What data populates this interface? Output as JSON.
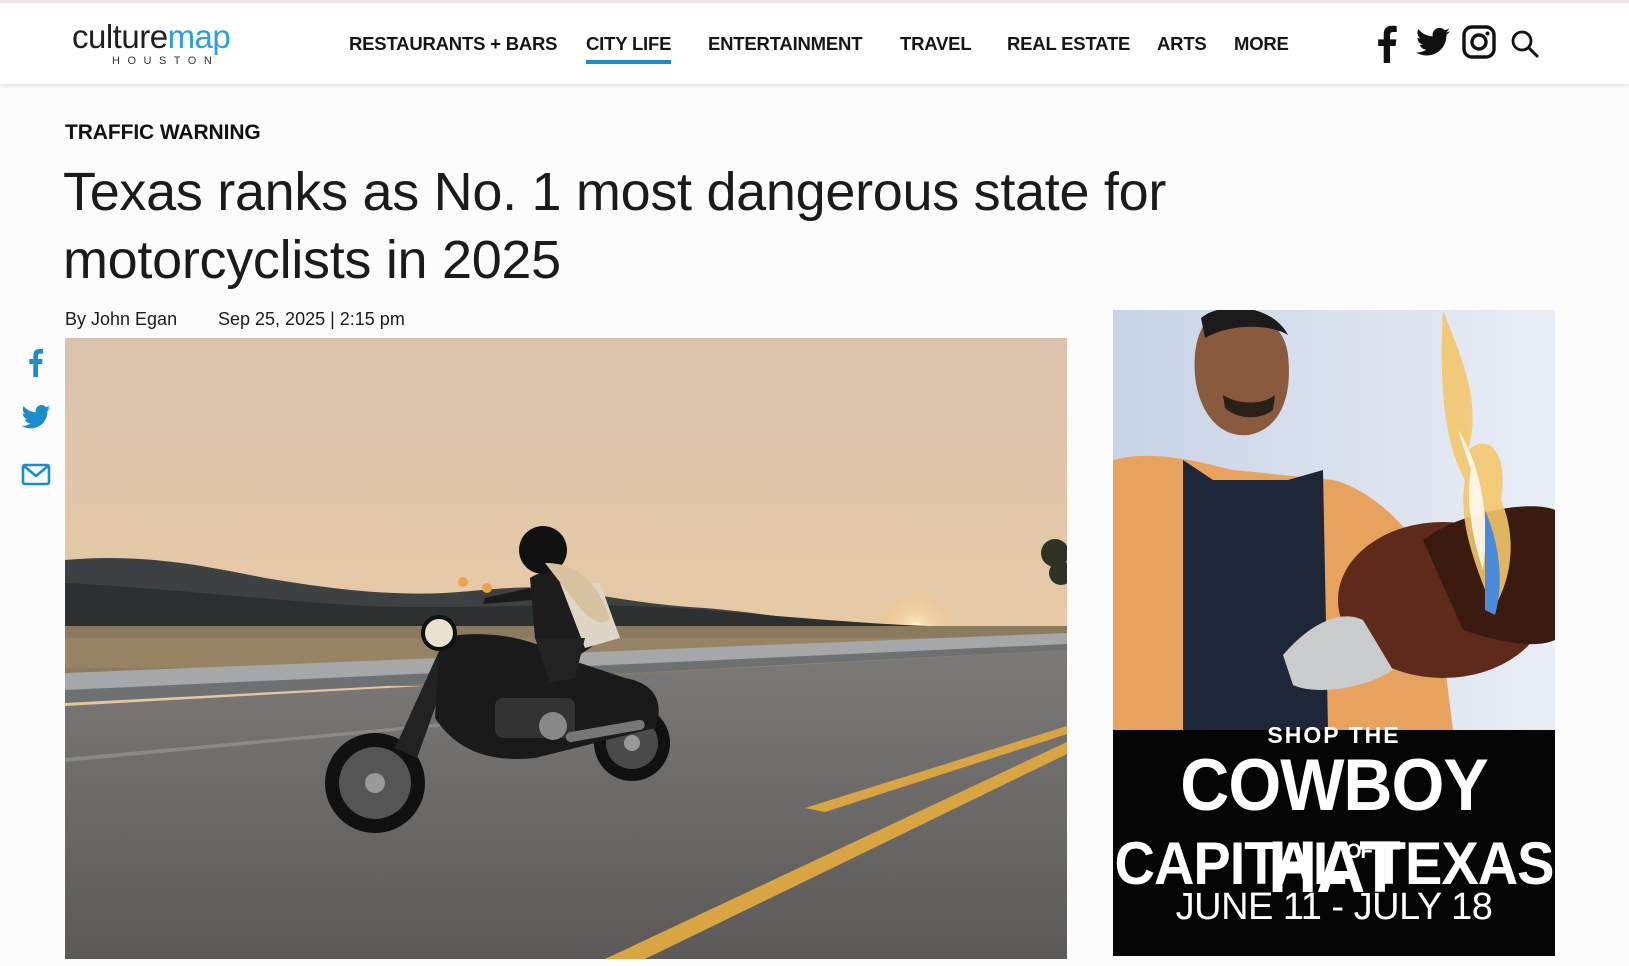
{
  "site": {
    "logo_part1": "culture",
    "logo_part2": "map",
    "city": "HOUSTON",
    "brand_color": "#2f9fd8"
  },
  "nav": {
    "items": [
      {
        "label": "RESTAURANTS + BARS",
        "active": false
      },
      {
        "label": "CITY LIFE",
        "active": true
      },
      {
        "label": "ENTERTAINMENT",
        "active": false
      },
      {
        "label": "TRAVEL",
        "active": false
      },
      {
        "label": "REAL ESTATE",
        "active": false
      },
      {
        "label": "ARTS",
        "active": false
      },
      {
        "label": "MORE",
        "active": false
      }
    ],
    "active_underline_color": "#1b8ec9",
    "social_icons": [
      "facebook-icon",
      "twitter-icon",
      "instagram-icon",
      "search-icon"
    ]
  },
  "article": {
    "kicker": "TRAFFIC WARNING",
    "headline": "Texas ranks as No. 1 most dangerous state for motorcyclists in 2025",
    "author": "By John Egan",
    "date": "Sep 25, 2025 | 2:15 pm",
    "share_icons": [
      "facebook-icon",
      "twitter-icon",
      "email-icon"
    ],
    "share_color": "#1b8ec9"
  },
  "ad": {
    "line_shop": "SHOP THE",
    "line_main": "COWBOY HAT",
    "line_capital": "CAPITAL",
    "line_of": "OF",
    "line_texas": "TEXAS",
    "dates": "JUNE 11 - JULY 18"
  }
}
